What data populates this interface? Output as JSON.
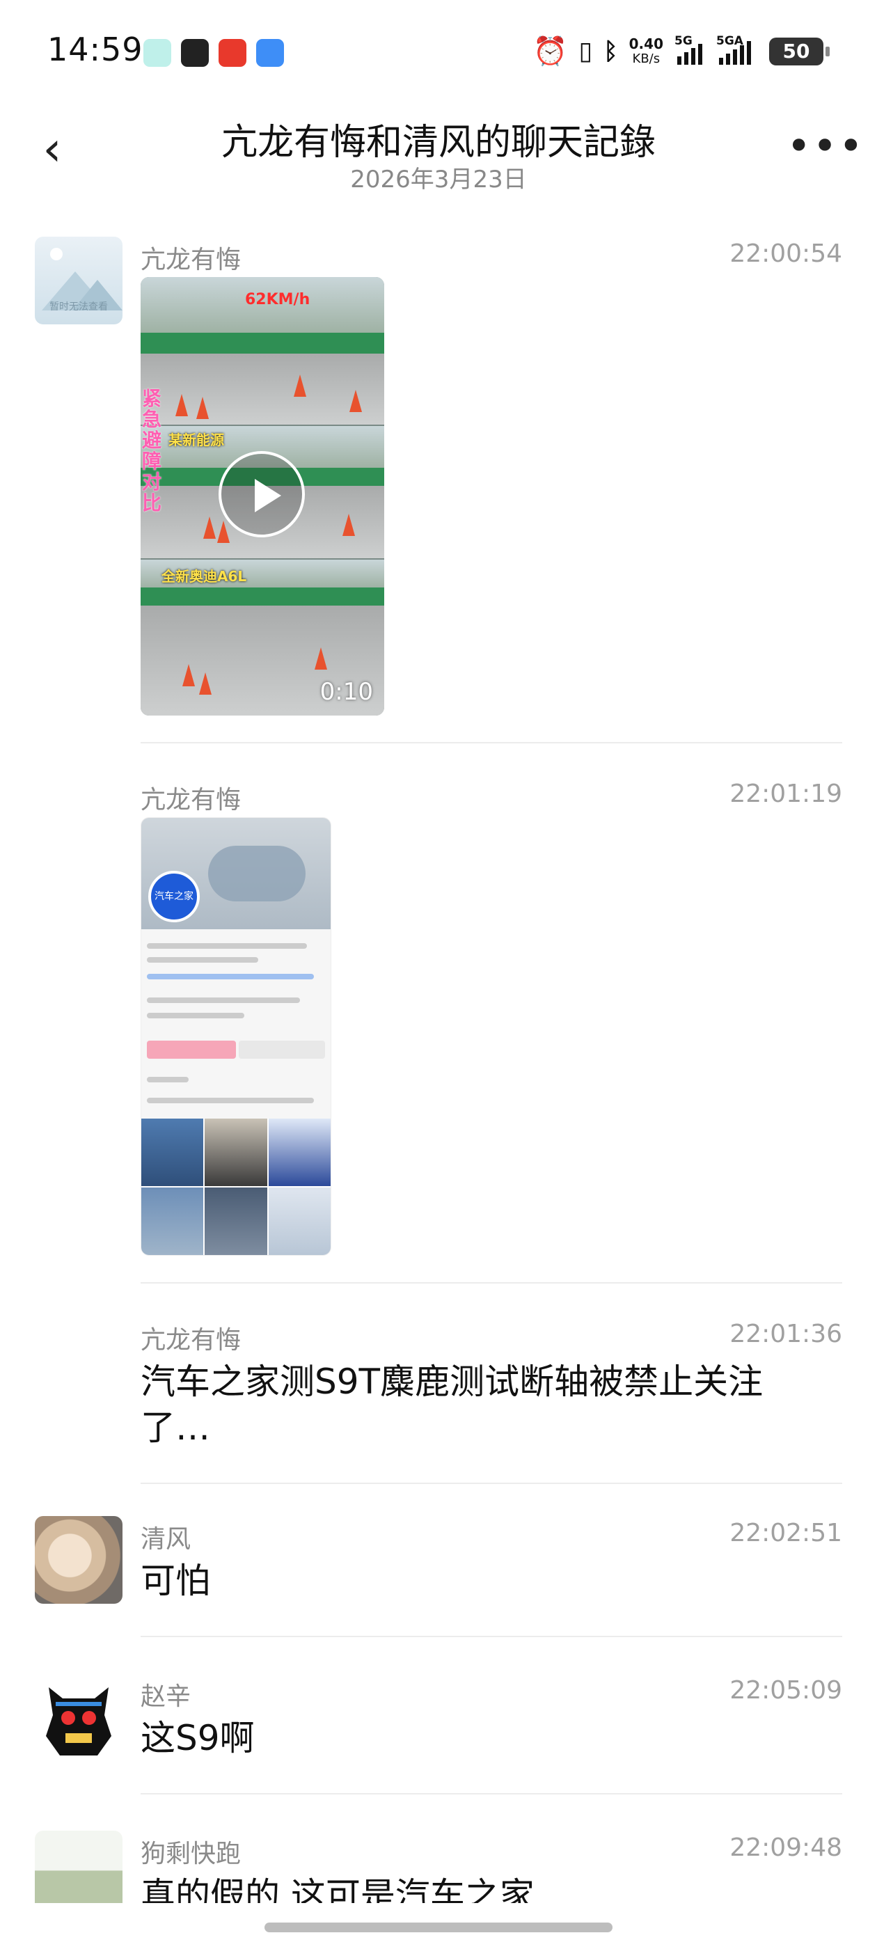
{
  "status_bar": {
    "time": "14:59",
    "net_speed_value": "0.40",
    "net_speed_unit": "KB/s",
    "signal1_label": "5G",
    "signal2_label": "5GA",
    "battery": "50"
  },
  "header": {
    "title": "亢龙有悔和清风的聊天記錄",
    "date": "2026年3月23日"
  },
  "messages": [
    {
      "sender": "亢龙有悔",
      "time": "22:00:54",
      "type": "video",
      "duration": "0:10",
      "overlay_speed": "62KM/h",
      "overlay_label_2": "某新能源",
      "overlay_label_3": "全新奥迪A6L",
      "overlay_side": "紧急避障对比"
    },
    {
      "sender": "亢龙有悔",
      "time": "22:01:19",
      "type": "image",
      "overlay_logo": "汽车之家"
    },
    {
      "sender": "亢龙有悔",
      "time": "22:01:36",
      "type": "text",
      "text": "汽车之家测S9T麋鹿测试断轴被禁止关注了…"
    },
    {
      "sender": "清风",
      "time": "22:02:51",
      "type": "text",
      "text": "可怕"
    },
    {
      "sender": "赵辛",
      "time": "22:05:09",
      "type": "text",
      "text": "这S9啊"
    },
    {
      "sender": "狗剩快跑",
      "time": "22:09:48",
      "type": "text",
      "text": "真的假的 这可是汽车之家"
    }
  ],
  "avatar_placeholder_caption": "暂时无法查看",
  "colors": {
    "timestamp": "#a0a0a0",
    "sender": "#8a8a8a",
    "divider": "#ececec"
  }
}
